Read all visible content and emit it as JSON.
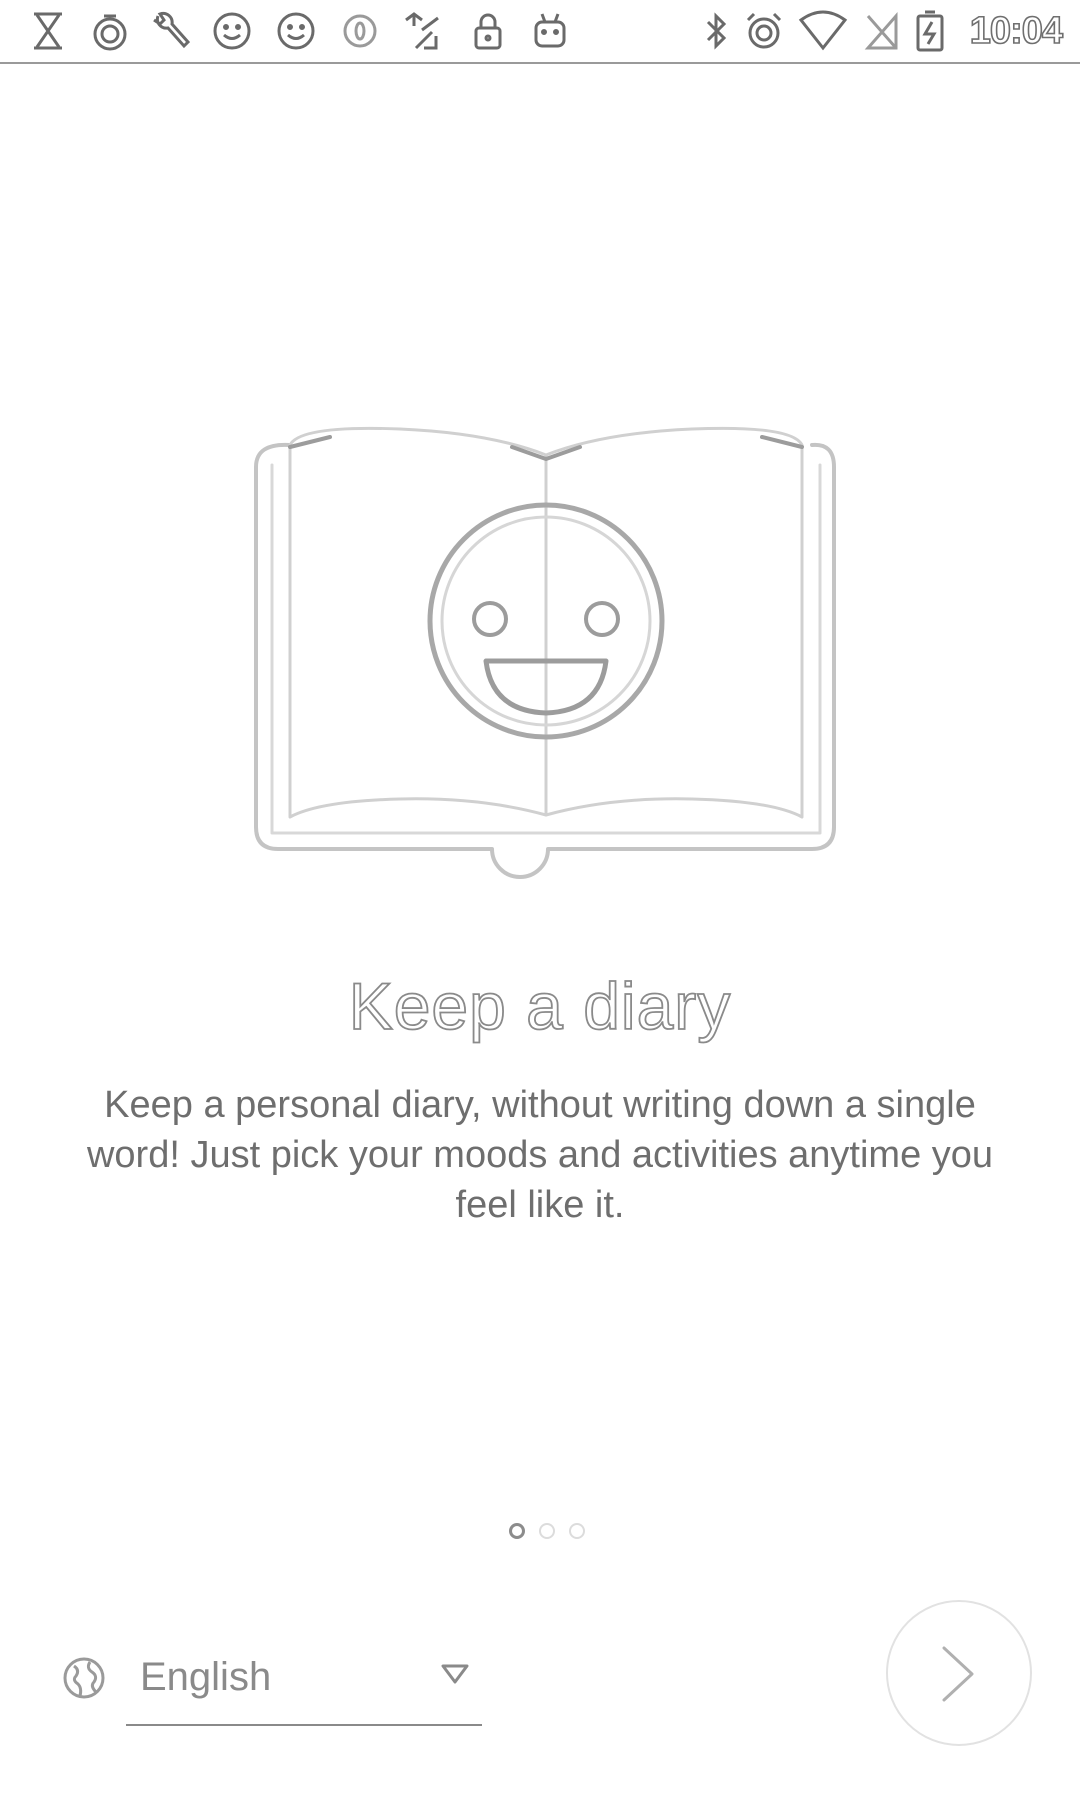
{
  "status_bar": {
    "left_icons": [
      "hourglass-icon",
      "timer-icon",
      "wrench-icon",
      "smiley-icon",
      "smiley-icon",
      "circle-o-icon",
      "wifi-sync-icon",
      "lock-icon",
      "android-icon"
    ],
    "right_icons": [
      "bluetooth-icon",
      "alarm-icon",
      "wifi-icon",
      "no-signal-icon",
      "battery-charging-icon"
    ],
    "time": "10:04"
  },
  "onboarding": {
    "illustration": "diary-book-smiley-icon",
    "title": "Keep a diary",
    "description": "Keep a personal diary, without writing down a single word! Just pick your moods and activities anytime you feel like it.",
    "page_indicator": {
      "total": 3,
      "current": 1
    }
  },
  "footer": {
    "language": {
      "icon": "globe-icon",
      "selected": "English"
    },
    "next_button": {
      "icon": "chevron-right-icon"
    }
  },
  "colors": {
    "background": "#ffffff",
    "text": "#6e6e6e",
    "outline": "#bdbdbd"
  }
}
